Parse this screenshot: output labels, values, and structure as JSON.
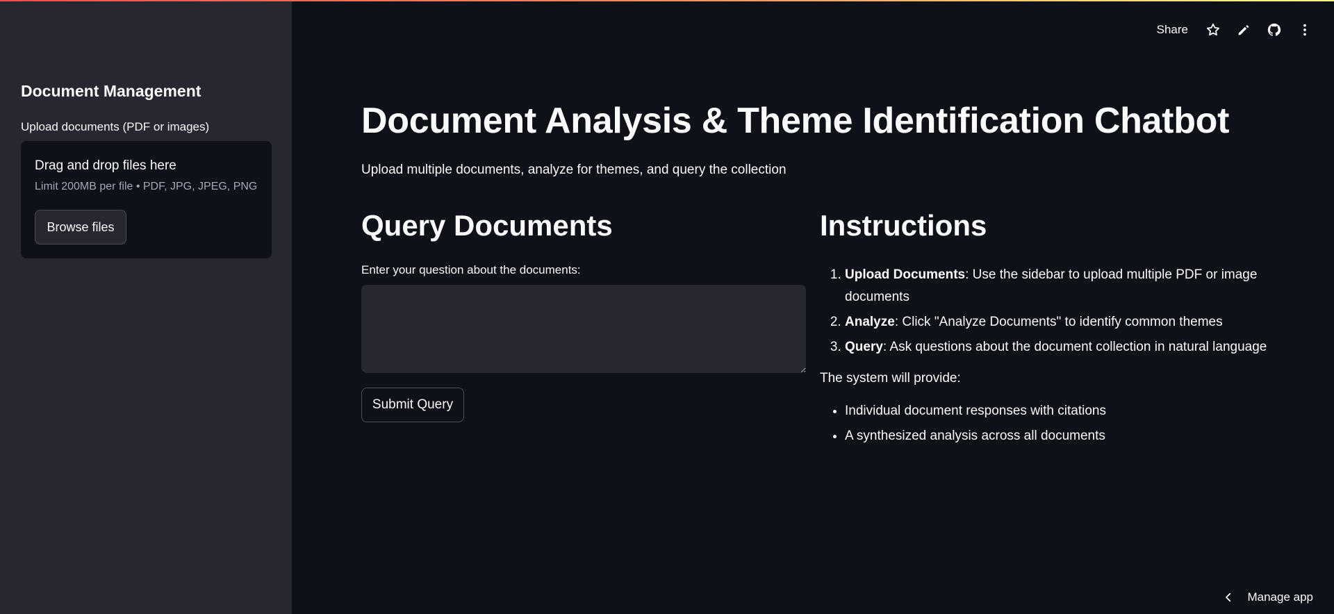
{
  "sidebar": {
    "title": "Document Management",
    "uploader_label": "Upload documents (PDF or images)",
    "dropzone_title": "Drag and drop files here",
    "dropzone_limit": "Limit 200MB per file • PDF, JPG, JPEG, PNG",
    "browse_button": "Browse files"
  },
  "toolbar": {
    "share_label": "Share",
    "icons": [
      "star-icon",
      "pencil-icon",
      "github-icon",
      "more-vertical-icon"
    ]
  },
  "main": {
    "title": "Document Analysis & Theme Identification Chatbot",
    "subtitle": "Upload multiple documents, analyze for themes, and query the collection",
    "query": {
      "heading": "Query Documents",
      "input_label": "Enter your question about the documents:",
      "input_value": "",
      "submit_button": "Submit Query"
    },
    "instructions": {
      "heading": "Instructions",
      "steps": [
        {
          "bold": "Upload Documents",
          "text": ": Use the sidebar to upload multiple PDF or image documents"
        },
        {
          "bold": "Analyze",
          "text": ": Click \"Analyze Documents\" to identify common themes"
        },
        {
          "bold": "Query",
          "text": ": Ask questions about the document collection in natural language"
        }
      ],
      "provide_label": "The system will provide:",
      "bullets": [
        "Individual document responses with citations",
        "A synthesized analysis across all documents"
      ]
    }
  },
  "footer": {
    "manage_label": "Manage app"
  },
  "colors": {
    "background": "#0e1117",
    "sidebar": "#262730",
    "text": "#fafafa",
    "muted": "#a3a8b8",
    "accent": "#ff4b4b"
  }
}
